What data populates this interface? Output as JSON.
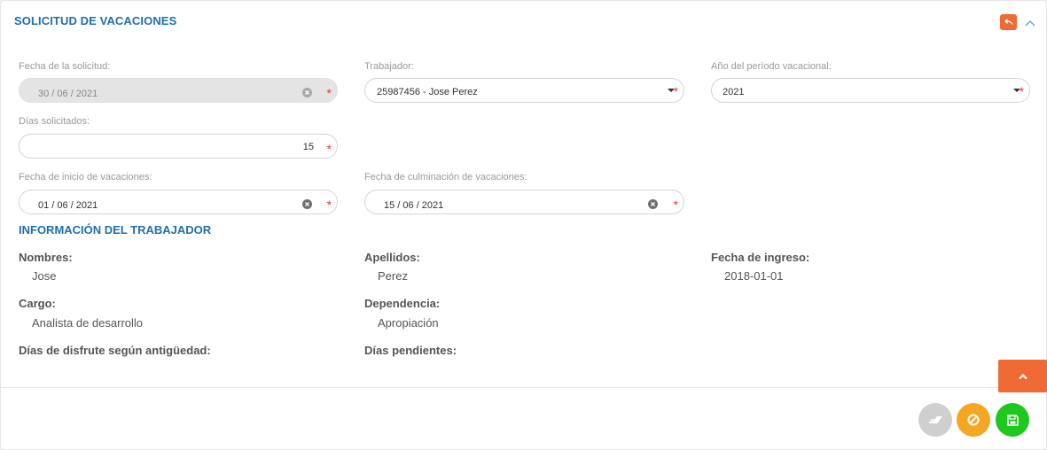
{
  "header": {
    "title": "SOLICITUD DE VACACIONES"
  },
  "form": {
    "fecha_solicitud": {
      "label": "Fecha de la solicitud:",
      "value": "30 / 06 / 2021"
    },
    "trabajador": {
      "label": "Trabajador:",
      "value": "25987456 - Jose Perez"
    },
    "anio_periodo": {
      "label": "Año del período vacacional:",
      "value": "2021"
    },
    "dias_solicitados": {
      "label": "Días solicitados:",
      "value": "15"
    },
    "fecha_inicio": {
      "label": "Fecha de inicio de vacaciones:",
      "value": "01 / 06 / 2021"
    },
    "fecha_culminacion": {
      "label": "Fecha de culminación de vacaciones:",
      "value": "15 / 06 / 2021"
    },
    "required_mark": "*"
  },
  "worker_info": {
    "title": "INFORMACIÓN DEL TRABAJADOR",
    "nombres": {
      "label": "Nombres:",
      "value": "Jose"
    },
    "apellidos": {
      "label": "Apellidos:",
      "value": "Perez"
    },
    "fecha_ingreso": {
      "label": "Fecha de ingreso:",
      "value": "2018-01-01"
    },
    "cargo": {
      "label": "Cargo:",
      "value": "Analista de desarrollo"
    },
    "dependencia": {
      "label": "Dependencia:",
      "value": "Apropiación"
    },
    "dias_disfrute": {
      "label": "Días de disfrute según antigüedad:"
    },
    "dias_pendientes": {
      "label": "Días pendientes:"
    }
  },
  "colors": {
    "accent": "#1e6fae",
    "orange": "#f06a35",
    "warning": "#f5a623",
    "success": "#1ec81e",
    "muted": "#cfcfcf",
    "required": "#e53935"
  },
  "icons": {
    "back": "undo-arrow-icon",
    "collapse": "chevron-up-icon",
    "clear": "clear-circle-icon",
    "dropdown": "caret-down-icon",
    "scroll_top": "chevron-up-icon",
    "eraser": "eraser-icon",
    "cancel": "ban-icon",
    "save": "floppy-disk-icon"
  }
}
